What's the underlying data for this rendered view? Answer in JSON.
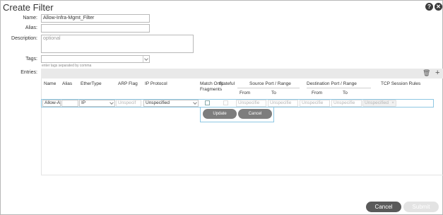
{
  "window": {
    "title": "Create Filter"
  },
  "header_icons": [
    "help-icon",
    "close-icon"
  ],
  "form": {
    "name": {
      "label": "Name:",
      "value": "Allow-Infra-Mgmt_Filter"
    },
    "alias": {
      "label": "Alias:",
      "value": ""
    },
    "description": {
      "label": "Description:",
      "placeholder": "optional"
    },
    "tags": {
      "label": "Tags:",
      "hint": "enter tags separated by comma"
    }
  },
  "entries": {
    "label": "Entries:",
    "columns": {
      "name": "Name",
      "alias": "Alias",
      "ethertype": "EtherType",
      "arp_flag": "ARP Flag",
      "ip_protocol": "IP Protocol",
      "match_only_fragments": "Match Only Fragments",
      "stateful": "Stateful",
      "source_port": "Source Port / Range",
      "destination_port": "Destination Port / Range",
      "tcp_session_rules": "TCP Session Rules",
      "from": "From",
      "to": "To"
    },
    "edit_row": {
      "name": "Allow-A",
      "alias": "",
      "ethertype": "IP",
      "arp_flag": "Unspecif",
      "ip_protocol": "Unspecified",
      "src_from": "Unspecifie",
      "src_to": "Unspecifie",
      "dst_from": "Unspecifie",
      "dst_to": "Unspecifie",
      "tcp_rules": "Unspecified"
    },
    "update_label": "Update",
    "cancel_label": "Cancel"
  },
  "footer": {
    "cancel_label": "Cancel",
    "submit_label": "Submit"
  }
}
